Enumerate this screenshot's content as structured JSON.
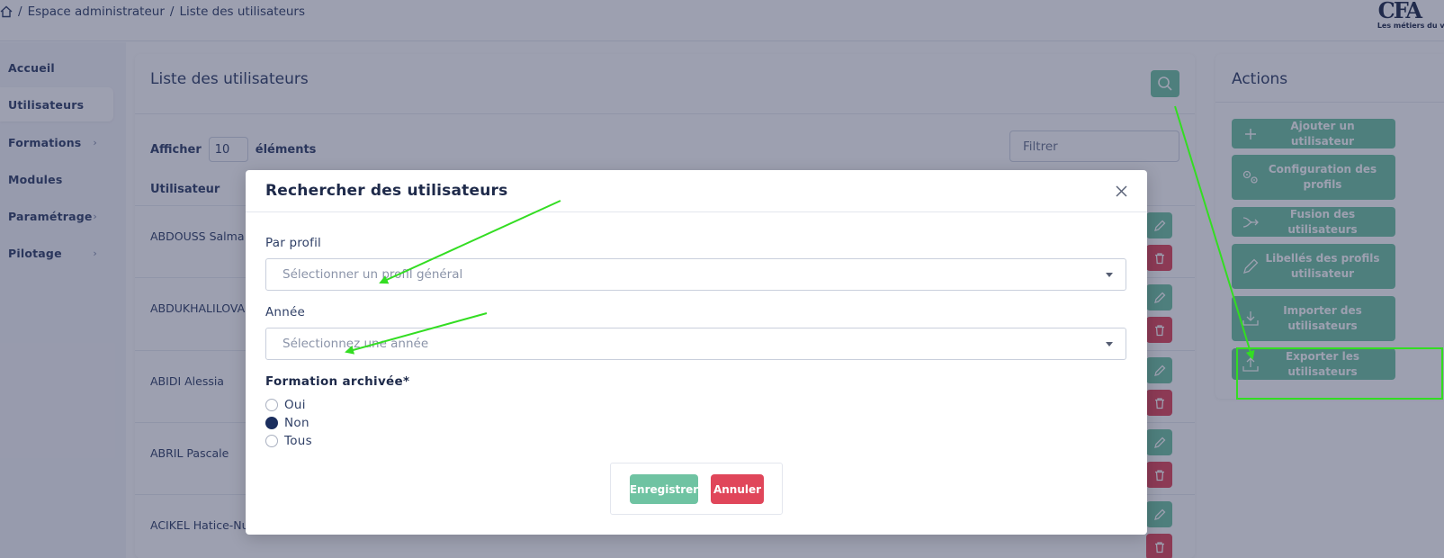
{
  "breadcrumb": {
    "home_icon": "home-icon",
    "separator": "/",
    "admin": "Espace administrateur",
    "current": "Liste des utilisateurs"
  },
  "logo": {
    "mark": "CFA",
    "tagline": "Les métiers du vé"
  },
  "sidebar": {
    "items": [
      {
        "label": "Accueil",
        "has_children": false,
        "active": false
      },
      {
        "label": "Utilisateurs",
        "has_children": false,
        "active": true
      },
      {
        "label": "Formations",
        "has_children": true,
        "active": false
      },
      {
        "label": "Modules",
        "has_children": false,
        "active": false
      },
      {
        "label": "Paramétrage",
        "has_children": true,
        "active": false
      },
      {
        "label": "Pilotage",
        "has_children": true,
        "active": false
      }
    ]
  },
  "users_card": {
    "title": "Liste des utilisateurs",
    "show_label": "Afficher",
    "page_size": "10",
    "elements_label": "éléments",
    "filter_placeholder": "Filtrer",
    "column_user": "Utilisateur",
    "rows": [
      {
        "name": "ABDOUSS Salma"
      },
      {
        "name": "ABDUKHALILOVA"
      },
      {
        "name": "ABIDI Alessia"
      },
      {
        "name": "ABRIL Pascale"
      },
      {
        "name": "ACIKEL Hatice-Nu"
      }
    ]
  },
  "actions_card": {
    "title": "Actions",
    "buttons": [
      {
        "label": "Ajouter un utilisateur",
        "icon": "plus-icon"
      },
      {
        "label": "Configuration des profils",
        "icon": "gears-icon"
      },
      {
        "label": "Fusion des utilisateurs",
        "icon": "merge-arrow-icon"
      },
      {
        "label": "Libellés des profils utilisateur",
        "icon": "pencil-icon"
      },
      {
        "label": "Importer des utilisateurs",
        "icon": "download-icon"
      },
      {
        "label": "Exporter les utilisateurs",
        "icon": "upload-icon"
      }
    ]
  },
  "modal": {
    "title": "Rechercher des utilisateurs",
    "profile_label": "Par profil",
    "profile_placeholder": "Sélectionner un profil général",
    "year_label": "Année",
    "year_placeholder": "Sélectionnez une année",
    "archived_label": "Formation archivée*",
    "archived_options": [
      {
        "label": "Oui",
        "checked": false
      },
      {
        "label": "Non",
        "checked": true
      },
      {
        "label": "Tous",
        "checked": false
      }
    ],
    "save_label": "Enregistrer",
    "cancel_label": "Annuler"
  },
  "colors": {
    "accent_green": "#6fc3a2",
    "danger_red": "#e0465a",
    "text_navy": "#1e2a4a",
    "annotation_green": "#33dd22"
  }
}
